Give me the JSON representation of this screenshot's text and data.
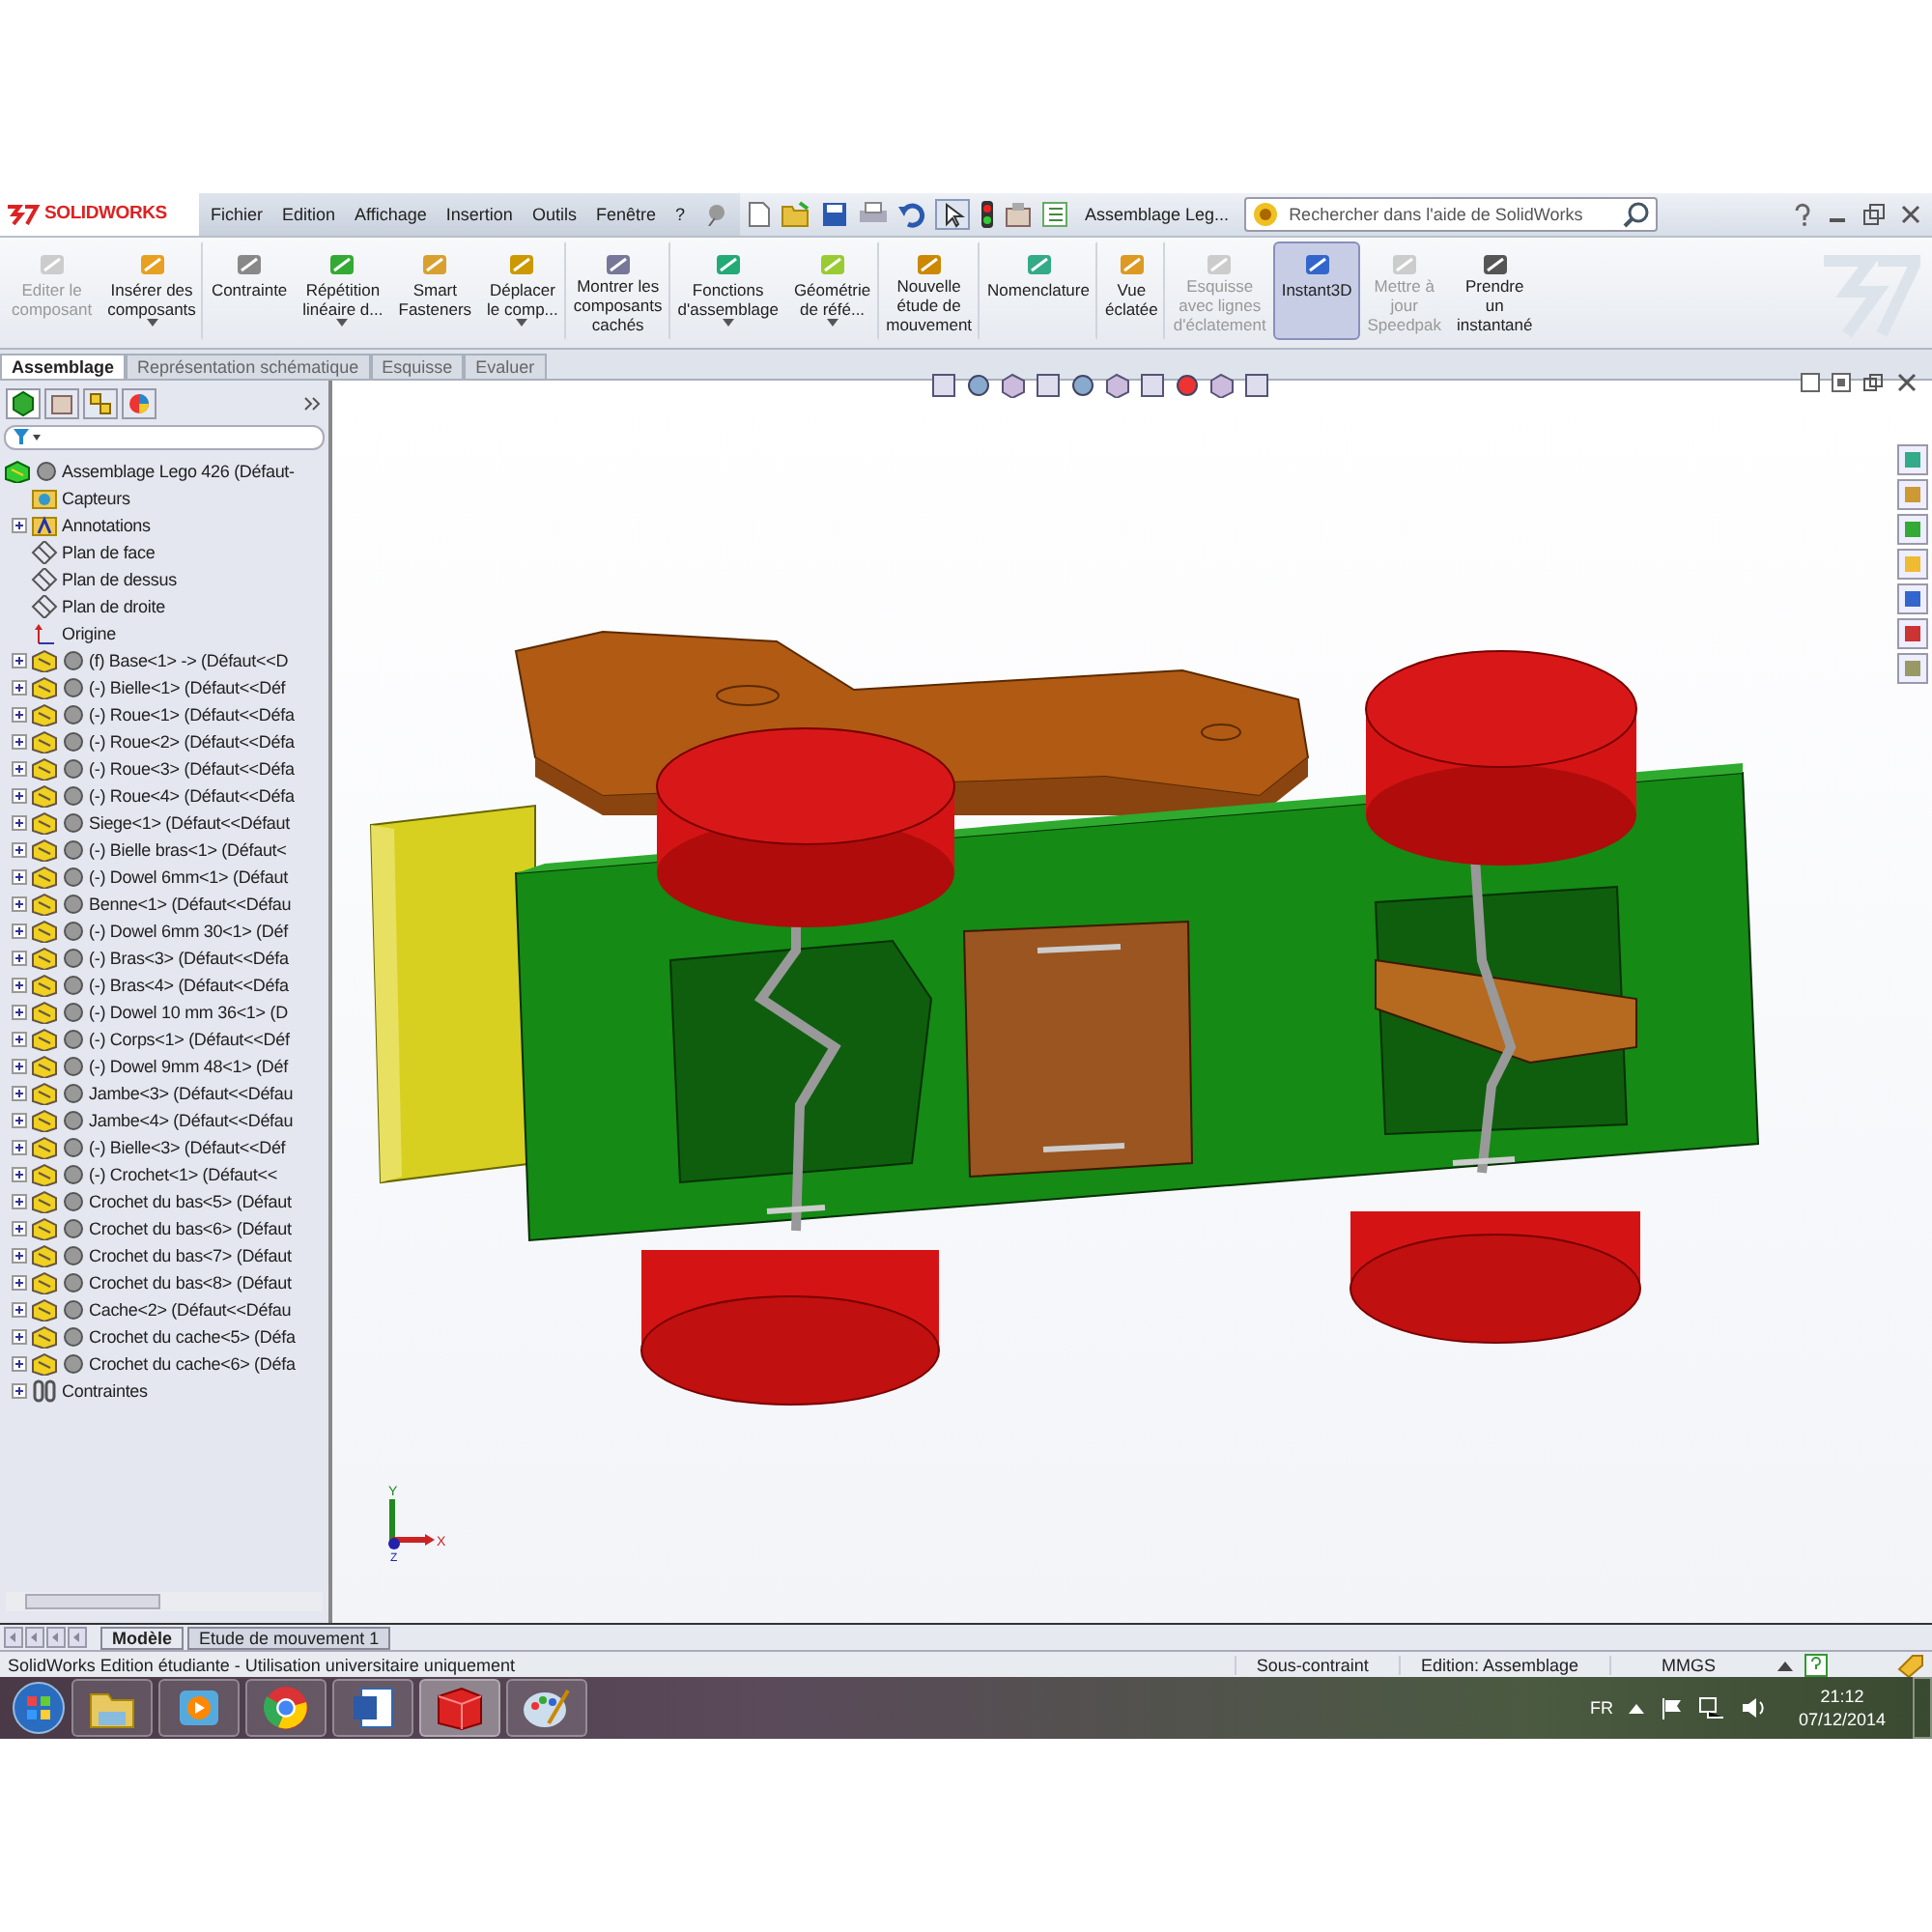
{
  "app": {
    "logo": "SOLIDWORKS",
    "menu": [
      "Fichier",
      "Edition",
      "Affichage",
      "Insertion",
      "Outils",
      "Fenêtre",
      "?"
    ],
    "document_title": "Assemblage Leg...",
    "search": {
      "placeholder": "Rechercher dans l'aide de SolidWorks"
    }
  },
  "commands": [
    {
      "label": "Editer le\ncomposant",
      "disabled": true,
      "selected": false,
      "dropdown": false
    },
    {
      "label": "Insérer des\ncomposants",
      "disabled": false,
      "selected": false,
      "dropdown": true
    },
    {
      "label": "Contrainte",
      "disabled": false,
      "selected": false,
      "dropdown": false
    },
    {
      "label": "Répétition\nlinéaire d...",
      "disabled": false,
      "selected": false,
      "dropdown": true
    },
    {
      "label": "Smart\nFasteners",
      "disabled": false,
      "selected": false,
      "dropdown": false
    },
    {
      "label": "Déplacer\nle comp...",
      "disabled": false,
      "selected": false,
      "dropdown": true
    },
    {
      "label": "Montrer les\ncomposants\ncachés",
      "disabled": false,
      "selected": false,
      "dropdown": false
    },
    {
      "label": "Fonctions\nd'assemblage",
      "disabled": false,
      "selected": false,
      "dropdown": true
    },
    {
      "label": "Géométrie\nde réfé...",
      "disabled": false,
      "selected": false,
      "dropdown": true
    },
    {
      "label": "Nouvelle\nétude de\nmouvement",
      "disabled": false,
      "selected": false,
      "dropdown": false
    },
    {
      "label": "Nomenclature",
      "disabled": false,
      "selected": false,
      "dropdown": false
    },
    {
      "label": "Vue\néclatée",
      "disabled": false,
      "selected": false,
      "dropdown": false
    },
    {
      "label": "Esquisse\navec lignes\nd'éclatement",
      "disabled": true,
      "selected": false,
      "dropdown": false
    },
    {
      "label": "Instant3D",
      "disabled": false,
      "selected": true,
      "dropdown": false
    },
    {
      "label": "Mettre à\njour\nSpeedpak",
      "disabled": true,
      "selected": false,
      "dropdown": false
    },
    {
      "label": "Prendre\nun\ninstantané",
      "disabled": false,
      "selected": false,
      "dropdown": false
    }
  ],
  "tabs": [
    {
      "label": "Assemblage",
      "selected": true
    },
    {
      "label": "Représentation schématique",
      "selected": false
    },
    {
      "label": "Esquisse",
      "selected": false
    },
    {
      "label": "Evaluer",
      "selected": false
    }
  ],
  "tree": [
    {
      "kind": "root",
      "label": "Assemblage Lego 426  (Défaut-",
      "children": [
        {
          "kind": "sensor",
          "label": "Capteurs",
          "expandable": false
        },
        {
          "kind": "annotation",
          "label": "Annotations",
          "expandable": true
        },
        {
          "kind": "plane",
          "label": "Plan de face",
          "expandable": false
        },
        {
          "kind": "plane",
          "label": "Plan de dessus",
          "expandable": false
        },
        {
          "kind": "plane",
          "label": "Plan de droite",
          "expandable": false
        },
        {
          "kind": "origin",
          "label": "Origine",
          "expandable": false
        },
        {
          "kind": "part",
          "label": "(f) Base<1> -> (Défaut<<D",
          "expandable": true
        },
        {
          "kind": "part",
          "label": "(-) Bielle<1> (Défaut<<Déf",
          "expandable": true
        },
        {
          "kind": "part",
          "label": "(-) Roue<1> (Défaut<<Défa",
          "expandable": true
        },
        {
          "kind": "part",
          "label": "(-) Roue<2> (Défaut<<Défa",
          "expandable": true
        },
        {
          "kind": "part",
          "label": "(-) Roue<3> (Défaut<<Défa",
          "expandable": true
        },
        {
          "kind": "part",
          "label": "(-) Roue<4> (Défaut<<Défa",
          "expandable": true
        },
        {
          "kind": "part",
          "label": "Siege<1> (Défaut<<Défaut",
          "expandable": true
        },
        {
          "kind": "part",
          "label": "(-) Bielle bras<1> (Défaut<",
          "expandable": true
        },
        {
          "kind": "part",
          "label": "(-) Dowel 6mm<1> (Défaut",
          "expandable": true
        },
        {
          "kind": "part",
          "label": "Benne<1> (Défaut<<Défau",
          "expandable": true
        },
        {
          "kind": "part",
          "label": "(-) Dowel 6mm 30<1> (Déf",
          "expandable": true
        },
        {
          "kind": "part",
          "label": "(-) Bras<3> (Défaut<<Défa",
          "expandable": true
        },
        {
          "kind": "part",
          "label": "(-) Bras<4> (Défaut<<Défa",
          "expandable": true
        },
        {
          "kind": "part",
          "label": "(-) Dowel 10 mm 36<1> (D",
          "expandable": true
        },
        {
          "kind": "part",
          "label": "(-) Corps<1> (Défaut<<Déf",
          "expandable": true
        },
        {
          "kind": "part",
          "label": "(-) Dowel 9mm 48<1> (Déf",
          "expandable": true
        },
        {
          "kind": "part",
          "label": "Jambe<3> (Défaut<<Défau",
          "expandable": true
        },
        {
          "kind": "part",
          "label": "Jambe<4> (Défaut<<Défau",
          "expandable": true
        },
        {
          "kind": "part",
          "label": "(-) Bielle<3> (Défaut<<Déf",
          "expandable": true
        },
        {
          "kind": "part",
          "label": "(-) Crochet<1> (Défaut<<",
          "expandable": true
        },
        {
          "kind": "part",
          "label": "Crochet du bas<5> (Défaut",
          "expandable": true
        },
        {
          "kind": "part",
          "label": "Crochet du bas<6> (Défaut",
          "expandable": true
        },
        {
          "kind": "part",
          "label": "Crochet du bas<7> (Défaut",
          "expandable": true
        },
        {
          "kind": "part",
          "label": "Crochet du bas<8> (Défaut",
          "expandable": true
        },
        {
          "kind": "part",
          "label": "Cache<2> (Défaut<<Défau",
          "expandable": true
        },
        {
          "kind": "part",
          "label": "Crochet du cache<5> (Défa",
          "expandable": true
        },
        {
          "kind": "part",
          "label": "Crochet du cache<6> (Défa",
          "expandable": true
        },
        {
          "kind": "mates",
          "label": "Contraintes",
          "expandable": true
        }
      ]
    }
  ],
  "triad_labels": [
    "Y",
    "X",
    "Z"
  ],
  "bottom_tabs": [
    {
      "label": "Modèle",
      "selected": true
    },
    {
      "label": "Etude de mouvement 1",
      "selected": false
    }
  ],
  "status_bar": {
    "message": "SolidWorks Edition étudiante - Utilisation universitaire uniquement",
    "fields": [
      "Sous-contraint",
      "Edition: Assemblage",
      "MMGS"
    ]
  },
  "taskbar": {
    "apps": [
      {
        "kind": "explorer"
      },
      {
        "kind": "media"
      },
      {
        "kind": "browser"
      },
      {
        "kind": "word"
      },
      {
        "kind": "solidworks"
      },
      {
        "kind": "paint"
      }
    ],
    "language": "FR",
    "time": "21:12",
    "date": "07/12/2014"
  }
}
